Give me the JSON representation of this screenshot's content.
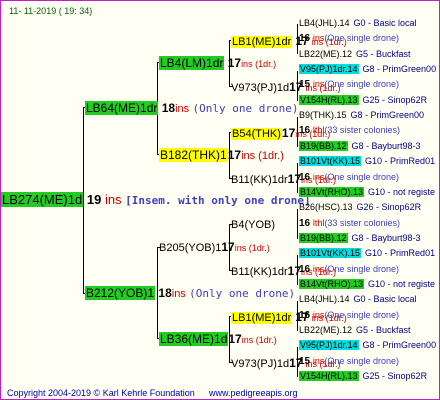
{
  "header": {
    "date": "11- 11-2019 ( 19: 34)"
  },
  "footer": {
    "copyright": "Copyright 2004-2019 © Karl Kehrle Foundation",
    "website": "www.pedigreeapis.org"
  },
  "root": {
    "id": "LB274(ME)1d",
    "count": "19",
    "ins": "ins",
    "note": "[Insem. with only one drone]"
  },
  "gen1": [
    {
      "id": "LB64(ME)1dr",
      "count": "18",
      "ins": "ins",
      "note": "(Only one drone)"
    },
    {
      "id": "B212(YOB)1",
      "count": "18",
      "ins": "ins",
      "note": "(Only one drone)"
    }
  ],
  "gen2": [
    {
      "id": "LB4(LM)1dr",
      "count": "17",
      "ins": "ins (1dr.)"
    },
    {
      "id": "B182(THK)1",
      "count": "17",
      "ins": "ins (1dr.)"
    },
    {
      "id": "B205(YOB)1",
      "count": "17",
      "ins": "ins (1dr.)"
    },
    {
      "id": "LB36(ME)1d",
      "count": "17",
      "ins": "ins (1dr.)"
    }
  ],
  "gen3": [
    {
      "id": "LB1(ME)1dr",
      "count": "17",
      "ins": "ins (1dr.)"
    },
    {
      "id": "V973(PJ)1d",
      "count": "17",
      "ins": "ins (1dr.)"
    },
    {
      "id": "B54(THK)",
      "count": "17",
      "ins": "ins (1dr.)"
    },
    {
      "id": "B11(KK)1dr",
      "count": "17",
      "ins": "ins (1dr.)"
    },
    {
      "id": "B4(YOB)"
    },
    {
      "id": "B11(KK)1dr",
      "count": "17",
      "ins": "ins (1dr.)"
    },
    {
      "id": "LB1(ME)1dr",
      "count": "17",
      "ins": "ins (1dr.)"
    },
    {
      "id": "V973(PJ)1d",
      "count": "17",
      "ins": "ins (1dr.)"
    }
  ],
  "gen4": [
    {
      "label": "LB4(JHL).14",
      "style": "plain",
      "ref": "G0 - Basic local"
    },
    {
      "num": "16",
      "ins": "ins",
      "note": "(One single drone)"
    },
    {
      "label": "LB22(ME).12",
      "style": "plain",
      "ref": "G5 - Buckfast"
    },
    {
      "label": "V95(PJ)1dr.14",
      "style": "c",
      "ref": "G8 - PrimGreen00"
    },
    {
      "num": "15",
      "ins": "ins",
      "note": "(One single drone)"
    },
    {
      "label": "V154H(RL).13",
      "style": "g",
      "ref": "G25 - Sinop62R"
    },
    {
      "label": "B9(THK).15",
      "style": "plain",
      "ref": "G8 - PrimGreen00"
    },
    {
      "num": "16",
      "ins": "lthl",
      "note": "(33 sister colonies)"
    },
    {
      "label": "B19(BB).12",
      "style": "g",
      "ref": "G8 - Bayburt98-3"
    },
    {
      "label": "B101Vt(KK).15",
      "style": "c",
      "ref": "G10 - PrimRed01"
    },
    {
      "num": "16",
      "ins": "ins",
      "note": "(One single drone)"
    },
    {
      "label": "B14Vt(RHO).13",
      "style": "g",
      "ref": "G10 - not registe"
    },
    {
      "label": "B26(HSC).13",
      "style": "plain",
      "ref": "G26 - Sinop62R"
    },
    {
      "num": "16",
      "ins": "lthl",
      "note": "(33 sister colonies)"
    },
    {
      "label": "B19(BB).12",
      "style": "g",
      "ref": "G8 - Bayburt98-3"
    },
    {
      "label": "B101Vt(KK).15",
      "style": "c",
      "ref": "G10 - PrimRed01"
    },
    {
      "num": "16",
      "ins": "ins",
      "note": "(One single drone)"
    },
    {
      "label": "B14Vt(RHO).13",
      "style": "g",
      "ref": "G10 - not registe"
    },
    {
      "label": "LB4(JHL).14",
      "style": "plain",
      "ref": "G0 - Basic local"
    },
    {
      "num": "16",
      "ins": "ins",
      "note": "(One single drone)"
    },
    {
      "label": "LB22(ME).12",
      "style": "plain",
      "ref": "G5 - Buckfast"
    },
    {
      "label": "V95(PJ)1dr.14",
      "style": "c",
      "ref": "G8 - PrimGreen00"
    },
    {
      "num": "15",
      "ins": "ins",
      "note": "(One single drone)"
    },
    {
      "label": "V154H(RL).13",
      "style": "g",
      "ref": "G25 - Sinop62R"
    }
  ]
}
